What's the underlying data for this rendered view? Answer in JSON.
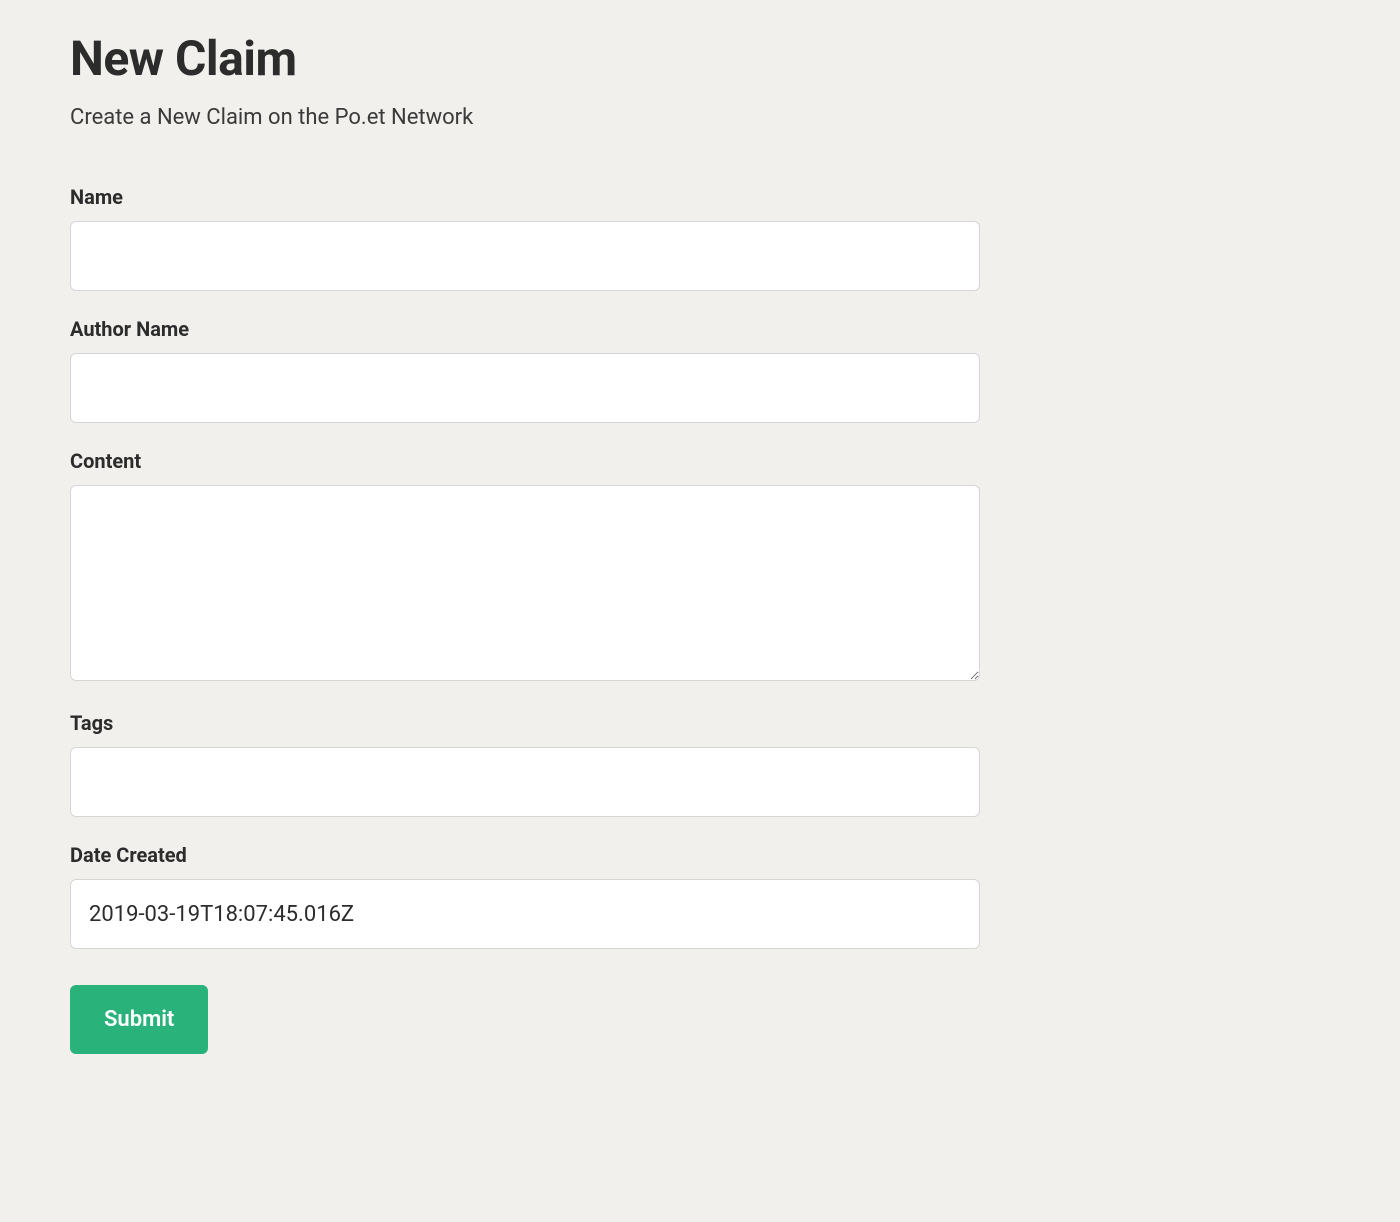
{
  "header": {
    "title": "New Claim",
    "subtitle": "Create a New Claim on the Po.et Network"
  },
  "form": {
    "name": {
      "label": "Name",
      "value": ""
    },
    "author_name": {
      "label": "Author Name",
      "value": ""
    },
    "content": {
      "label": "Content",
      "value": ""
    },
    "tags": {
      "label": "Tags",
      "value": ""
    },
    "date_created": {
      "label": "Date Created",
      "value": "2019-03-19T18:07:45.016Z"
    },
    "submit_label": "Submit"
  }
}
